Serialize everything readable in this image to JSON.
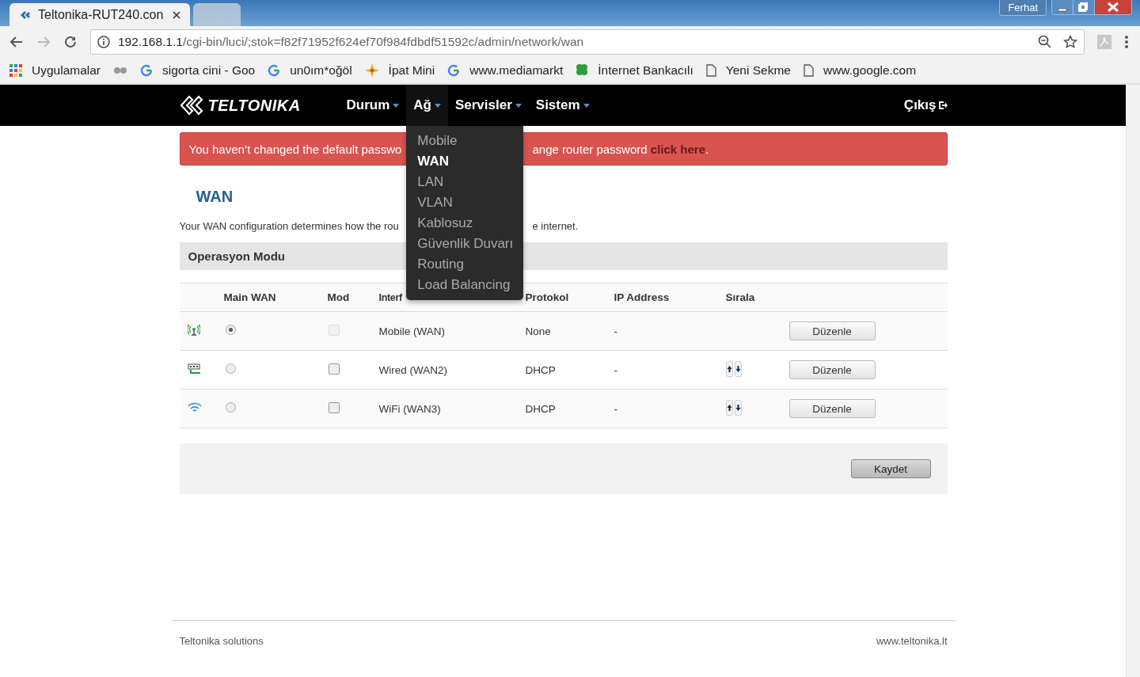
{
  "browser": {
    "tabs": [
      {
        "title": "Teltonika-RUT240.con",
        "selected": true
      },
      {
        "selected": false
      }
    ],
    "user": "Ferhat",
    "url_host": "192.168.1.1",
    "url_path": "/cgi-bin/luci/;stok=f82f71952f624ef70f984fdbdf51592c/admin/network/wan",
    "bookmarks": [
      {
        "label": "Uygulamalar",
        "kind": "apps"
      },
      {
        "kind": "mask"
      },
      {
        "label": "sigorta cini - Goo",
        "kind": "google"
      },
      {
        "label": "un0ım*oğöl",
        "kind": "google"
      },
      {
        "label": "İpat Mini",
        "kind": "star"
      },
      {
        "label": "www.mediamarkt",
        "kind": "google"
      },
      {
        "label": "İnternet Bankacılı",
        "kind": "clover"
      },
      {
        "label": "Yeni Sekme",
        "kind": "page"
      },
      {
        "label": "www.google.com",
        "kind": "page"
      }
    ]
  },
  "nav": {
    "logo": "TELTONIKA",
    "items": [
      {
        "label": "Durum",
        "selected": false
      },
      {
        "label": "Ağ",
        "selected": true
      },
      {
        "label": "Servisler",
        "selected": false
      },
      {
        "label": "Sistem",
        "selected": false
      }
    ],
    "logout": "Çıkış",
    "dropdown": [
      {
        "label": "Mobile",
        "selected": false
      },
      {
        "label": "WAN",
        "selected": true
      },
      {
        "label": "LAN",
        "selected": false
      },
      {
        "label": "VLAN",
        "selected": false
      },
      {
        "label": "Kablosuz",
        "selected": false
      },
      {
        "label": "Güvenlik Duvarı",
        "selected": false
      },
      {
        "label": "Routing",
        "selected": false
      },
      {
        "label": "Load Balancing",
        "selected": false
      }
    ]
  },
  "alert": {
    "text_left": "You haven’t changed the default passwo",
    "text_right": "ange router password ",
    "link": "click here",
    "end": "."
  },
  "title": "WAN",
  "description_left": "Your WAN configuration determines how the rou",
  "description_right": "e internet.",
  "section": "Operasyon Modu",
  "table": {
    "columns": [
      "Main WAN",
      "Mod",
      "Interf",
      "Protokol",
      "IP Address",
      "Sırala"
    ],
    "rows": [
      {
        "kind": "mobile",
        "main": true,
        "mod_checked": false,
        "mod_disabled": true,
        "interface": "Mobile (WAN)",
        "protocol": "None",
        "ip": "-",
        "sortable": false,
        "button": "Düzenle"
      },
      {
        "kind": "wired",
        "main": false,
        "mod_checked": false,
        "mod_disabled": false,
        "interface": "Wired (WAN2)",
        "protocol": "DHCP",
        "ip": "-",
        "sortable": true,
        "button": "Düzenle"
      },
      {
        "kind": "wifi",
        "main": false,
        "mod_checked": false,
        "mod_disabled": false,
        "interface": "WiFi (WAN3)",
        "protocol": "DHCP",
        "ip": "-",
        "sortable": true,
        "button": "Düzenle"
      }
    ]
  },
  "save": "Kaydet",
  "footer": {
    "left": "Teltonika solutions",
    "right": "www.teltonika.lt"
  }
}
